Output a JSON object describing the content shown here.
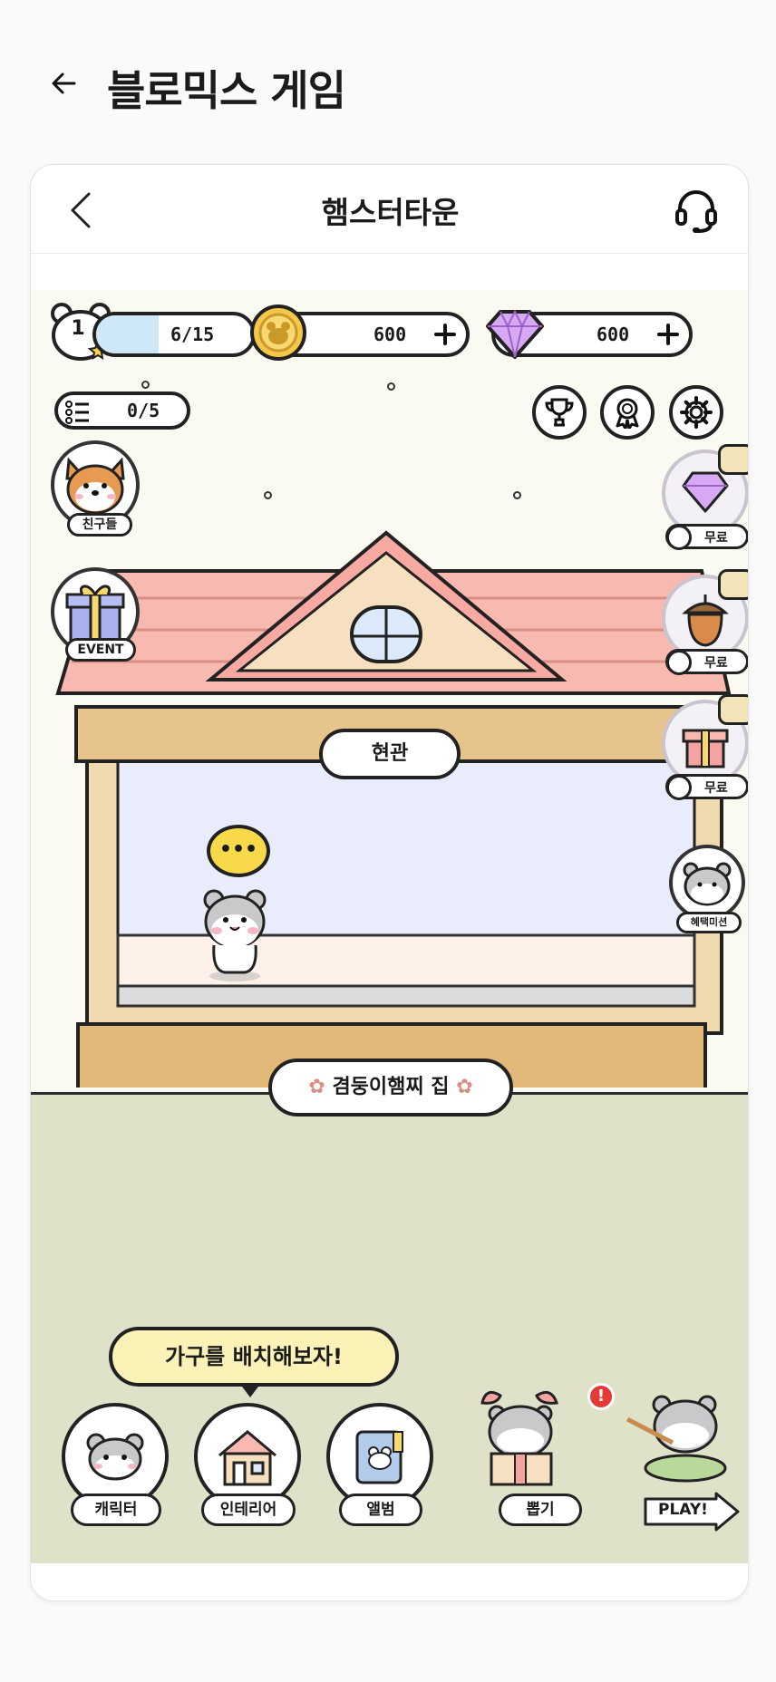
{
  "page": {
    "title": "블로믹스 게임"
  },
  "card": {
    "title": "햄스터타운"
  },
  "stats": {
    "level": "1",
    "exp": "6/15",
    "exp_fraction": 0.4,
    "coins": "600",
    "gems": "600",
    "quests": "0/5"
  },
  "side_left": [
    {
      "label": "친구들",
      "icon": "shiba-dog-icon"
    },
    {
      "label": "EVENT",
      "icon": "gift-box-icon"
    }
  ],
  "side_right": [
    {
      "label": "무료",
      "icon": "gem-icon"
    },
    {
      "label": "무료",
      "icon": "acorn-icon"
    },
    {
      "label": "무료",
      "icon": "gift-box-icon"
    },
    {
      "label": "혜택미션",
      "icon": "hamster-icon"
    }
  ],
  "house": {
    "door_sign": "현관",
    "name_plate": "겸둥이햄찌 집",
    "speech_bubble": "•••"
  },
  "tip": "가구를 배치해보자!",
  "bottom_menu": [
    {
      "label": "캐릭터",
      "icon": "hamster-face-icon"
    },
    {
      "label": "인테리어",
      "icon": "house-icon"
    },
    {
      "label": "앨범",
      "icon": "album-icon"
    },
    {
      "label": "뽑기",
      "icon": "hamster-gift-icon"
    },
    {
      "label": "PLAY!",
      "icon": "hamster-play-icon"
    }
  ],
  "colors": {
    "exp_bar": "#cfe8f8",
    "roof": "#f7b9b0",
    "wood": "#e6c48c",
    "wall": "#e8ecfb",
    "ground": "#dfe1c9",
    "sky": "#fbfaf2",
    "notification": "#e53935"
  }
}
